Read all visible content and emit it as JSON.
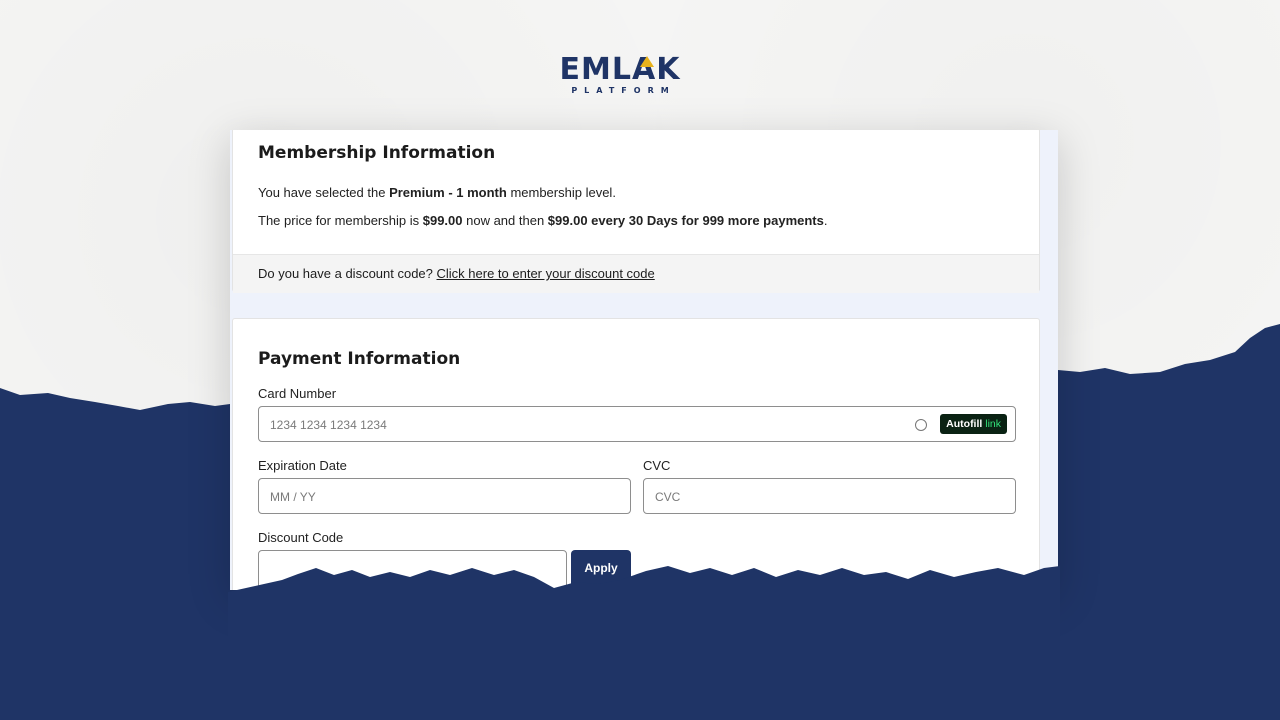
{
  "brand": {
    "name": "EMLAK",
    "tagline": "PLATFORM",
    "primary_color": "#1f3466",
    "accent_color": "#e8b21c"
  },
  "membership": {
    "title": "Membership Information",
    "line1_prefix": "You have selected the ",
    "line1_level": "Premium - 1 month",
    "line1_suffix": " membership level.",
    "line2_prefix": "The price for membership is ",
    "line2_price": "$99.00",
    "line2_middle": " now and then ",
    "line2_recurring": "$99.00 every 30 Days for 999 more payments",
    "line2_end": ".",
    "discount_question": "Do you have a discount code? ",
    "discount_link": "Click here to enter your discount code"
  },
  "payment": {
    "title": "Payment Information",
    "card_number_label": "Card Number",
    "card_number_placeholder": "1234 1234 1234 1234",
    "autofill_label": "Autofill",
    "autofill_link": "link",
    "expiration_label": "Expiration Date",
    "expiration_placeholder": "MM / YY",
    "cvc_label": "CVC",
    "cvc_placeholder": "CVC",
    "discount_code_label": "Discount Code",
    "discount_code_value": "",
    "apply_label": "Apply"
  }
}
